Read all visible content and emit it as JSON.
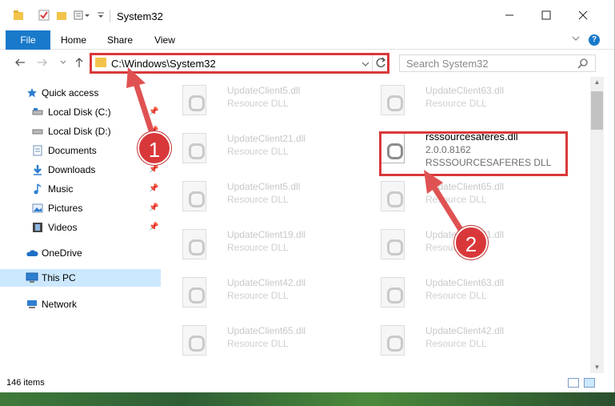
{
  "window": {
    "title": "System32",
    "quick_access_icons": [
      "folder-icon",
      "properties-check-icon",
      "new-folder-icon",
      "customize-icon"
    ]
  },
  "ribbon": {
    "tabs": [
      "File",
      "Home",
      "Share",
      "View"
    ],
    "expand_icon": "chevron-down-icon",
    "help_label": "?"
  },
  "address_bar": {
    "path": "C:\\Windows\\System32",
    "search_placeholder": "Search System32"
  },
  "navigation": {
    "items": [
      {
        "label": "Quick access",
        "icon": "star-icon",
        "pinned": false
      },
      {
        "label": "Local Disk (C:)",
        "icon": "drive-icon",
        "pinned": true
      },
      {
        "label": "Local Disk (D:)",
        "icon": "drive-icon",
        "pinned": true
      },
      {
        "label": "Documents",
        "icon": "documents-icon",
        "pinned": true
      },
      {
        "label": "Downloads",
        "icon": "downloads-icon",
        "pinned": true
      },
      {
        "label": "Music",
        "icon": "music-icon",
        "pinned": true
      },
      {
        "label": "Pictures",
        "icon": "pictures-icon",
        "pinned": true
      },
      {
        "label": "Videos",
        "icon": "videos-icon",
        "pinned": true
      },
      {
        "label": "OneDrive",
        "icon": "cloud-icon",
        "pinned": false
      },
      {
        "label": "This PC",
        "icon": "computer-icon",
        "pinned": false,
        "selected": true
      },
      {
        "label": "Network",
        "icon": "network-icon",
        "pinned": false
      }
    ]
  },
  "files": {
    "left_column": [
      {
        "name": "UpdateClient5.dll",
        "type": "Resource DLL"
      },
      {
        "name": "UpdateClient21.dll",
        "type": "Resource DLL"
      },
      {
        "name": "UpdateClient5.dll",
        "type": "Resource DLL"
      },
      {
        "name": "UpdateClient19.dll",
        "type": "Resource DLL"
      },
      {
        "name": "UpdateClient42.dll",
        "type": "Resource DLL"
      },
      {
        "name": "UpdateClient65.dll",
        "type": "Resource DLL"
      }
    ],
    "right_column": [
      {
        "name": "UpdateClient63.dll",
        "type": "Resource DLL"
      },
      {
        "name": "rsssourcesaferes.dll",
        "version": "2.0.0.8162",
        "type": "RSSSOURCESAFERES DLL",
        "highlighted": true
      },
      {
        "name": "UpdateClient65.dll",
        "type": "Resource DLL"
      },
      {
        "name": "UpdateClient31.dll",
        "type": "Resource DLL"
      },
      {
        "name": "UpdateClient63.dll",
        "type": "Resource DLL"
      },
      {
        "name": "UpdateClient42.dll",
        "type": "Resource DLL"
      }
    ]
  },
  "status": {
    "item_count": "146 items"
  },
  "callouts": [
    {
      "number": "1",
      "target": "address bar"
    },
    {
      "number": "2",
      "target": "rsssourcesaferes.dll"
    }
  ],
  "colors": {
    "accent": "#1979ca",
    "callout_red": "#d9383a",
    "selection": "#cce8ff"
  }
}
